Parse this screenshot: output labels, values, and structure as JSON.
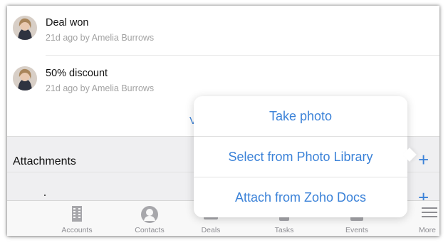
{
  "notes": [
    {
      "title": "Deal won",
      "meta": "21d ago by Amelia Burrows"
    },
    {
      "title": "50% discount",
      "meta": "21d ago by Amelia Burrows"
    }
  ],
  "notes_footer": {
    "partial_text": "V"
  },
  "attachments": {
    "label": "Attachments",
    "add_icon": "plus-icon"
  },
  "popover": {
    "items": [
      "Take photo",
      "Select from Photo Library",
      "Attach from Zoho Docs"
    ]
  },
  "tabbar": {
    "tabs": [
      {
        "label": "Accounts",
        "icon": "building-icon"
      },
      {
        "label": "Contacts",
        "icon": "person-icon"
      },
      {
        "label": "Deals",
        "icon": "deals-icon"
      },
      {
        "label": "Tasks",
        "icon": "tasks-icon"
      },
      {
        "label": "Events",
        "icon": "calendar-icon"
      },
      {
        "label": "More",
        "icon": "menu-icon"
      }
    ]
  },
  "colors": {
    "accent": "#3b82d8",
    "muted": "#8e8e93",
    "section_bg": "#efeff1"
  }
}
